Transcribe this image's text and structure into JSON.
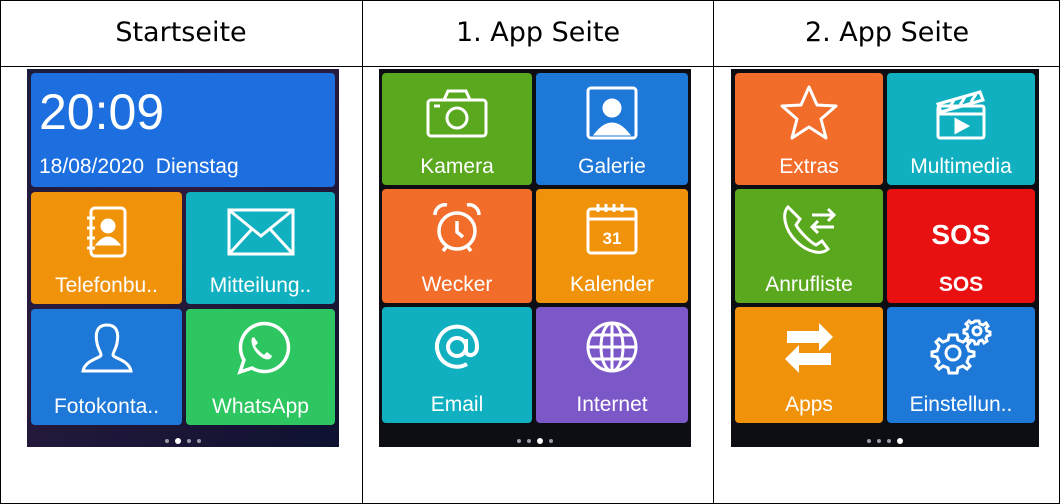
{
  "columns": [
    {
      "title": "Startseite"
    },
    {
      "title": "1. App Seite"
    },
    {
      "title": "2. App Seite"
    }
  ],
  "home": {
    "time": "20:09",
    "date": "18/08/2020",
    "weekday": "Dienstag",
    "tiles": [
      {
        "label": "Telefonbu..",
        "icon": "phonebook-icon",
        "color": "#f0920a"
      },
      {
        "label": "Mitteilung..",
        "icon": "envelope-icon",
        "color": "#10b0c0"
      },
      {
        "label": "Fotokonta..",
        "icon": "person-icon",
        "color": "#1d78d8"
      },
      {
        "label": "WhatsApp",
        "icon": "whatsapp-icon",
        "color": "#2dc660"
      }
    ],
    "page_index": 1,
    "page_count": 4
  },
  "app1": {
    "tiles": [
      {
        "label": "Kamera",
        "icon": "camera-icon",
        "color": "#5aa81e"
      },
      {
        "label": "Galerie",
        "icon": "gallery-icon",
        "color": "#1d78d8"
      },
      {
        "label": "Wecker",
        "icon": "alarm-clock-icon",
        "color": "#f26c2a"
      },
      {
        "label": "Kalender",
        "icon": "calendar-icon",
        "color": "#f0920a"
      },
      {
        "label": "Email",
        "icon": "at-sign-icon",
        "color": "#10b0c0"
      },
      {
        "label": "Internet",
        "icon": "globe-icon",
        "color": "#7b57c8"
      }
    ],
    "calendar_day": "31",
    "page_index": 2,
    "page_count": 4
  },
  "app2": {
    "tiles": [
      {
        "label": "Extras",
        "icon": "star-icon",
        "color": "#f26c2a"
      },
      {
        "label": "Multimedia",
        "icon": "clapperboard-icon",
        "color": "#10b0c0"
      },
      {
        "label": "Anrufliste",
        "icon": "call-log-icon",
        "color": "#5aa81e"
      },
      {
        "label": "SOS",
        "icon": "sos-icon",
        "color": "#e81010",
        "icon_text": "SOS"
      },
      {
        "label": "Apps",
        "icon": "swap-arrows-icon",
        "color": "#f0920a"
      },
      {
        "label": "Einstellun..",
        "icon": "gears-icon",
        "color": "#1d78d8"
      }
    ],
    "page_index": 3,
    "page_count": 4
  }
}
